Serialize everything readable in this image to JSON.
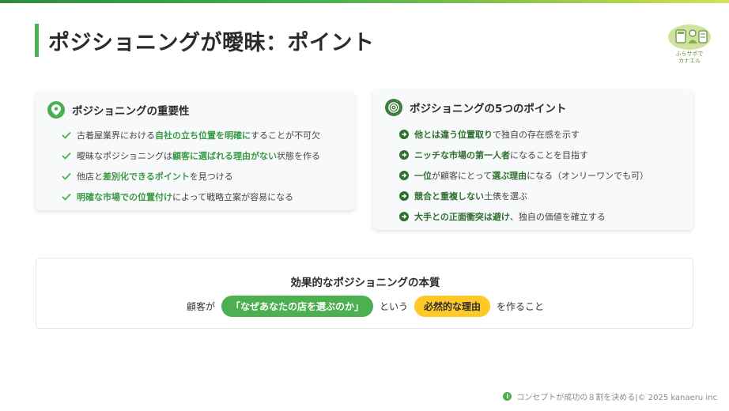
{
  "title": "ポジショニングが曖昧：ポイント",
  "logo": {
    "text_line1": "ふらサポで",
    "text_line2": "カナエル"
  },
  "left_card": {
    "title": "ポジショニングの重要性",
    "icon": "map-pin-icon",
    "items": [
      {
        "pre": "古着屋業界における",
        "hl": "自社の立ち位置を明確に",
        "post": "することが不可欠"
      },
      {
        "pre": "曖昧なポジショニングは",
        "hl": "顧客に選ばれる理由がない",
        "post": "状態を作る"
      },
      {
        "pre": "他店と",
        "hl": "差別化できるポイント",
        "post": "を見つける"
      },
      {
        "pre": "",
        "hl": "明確な市場での位置付け",
        "post": "によって戦略立案が容易になる"
      }
    ]
  },
  "right_card": {
    "title": "ポジショニングの5つのポイント",
    "icon": "target-icon",
    "items": [
      {
        "pre": "",
        "hl": "他とは違う位置取り",
        "post": "で独自の存在感を示す"
      },
      {
        "pre": "",
        "hl": "ニッチな市場の第一人者",
        "post": "になることを目指す"
      },
      {
        "pre": "",
        "hl": "一位",
        "post": "が顧客にとって",
        "hl2": "選ぶ理由",
        "post2": "になる（オンリーワンでも可）"
      },
      {
        "pre": "",
        "hl": "競合と重複しない",
        "post": "土俵を選ぶ"
      },
      {
        "pre": "",
        "hl": "大手との正面衝突は避け",
        "post": "、独自の価値を確立する"
      }
    ]
  },
  "essence": {
    "title": "効果的なポジショニングの本質",
    "text1": "顧客が",
    "pill1": "「なぜあなたの店を選ぶのか」",
    "text2": "という",
    "pill2": "必然的な理由",
    "text3": "を作ること"
  },
  "footer": {
    "text": "コンセプトが成功の８割を決める|© 2025 kanaeru inc"
  },
  "colors": {
    "accent_green": "#4caf50",
    "dark_green": "#2f6f2f",
    "yellow": "#ffc928"
  }
}
